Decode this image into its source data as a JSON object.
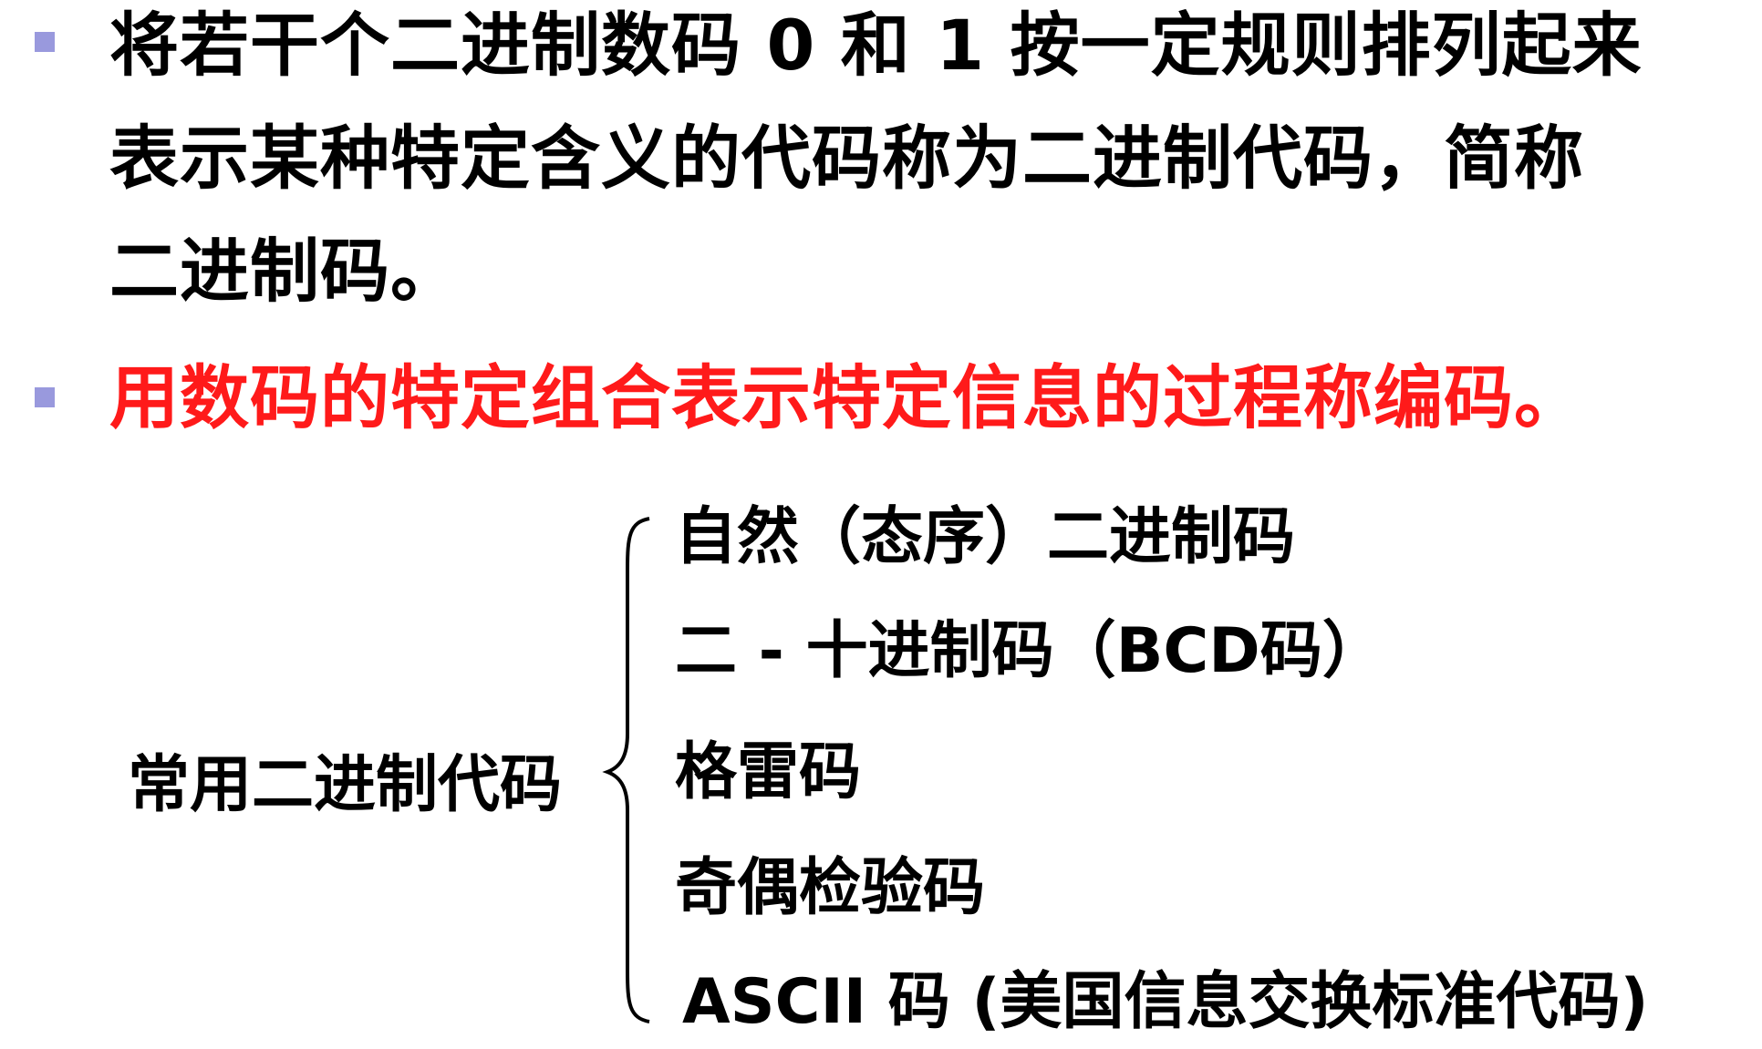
{
  "paragraphs": [
    {
      "lines": [
        "将若干个二进制数码 0 和 1 按一定规则排列起来",
        "表示某种特定含义的代码称为二进制代码，简称",
        "二进制码。"
      ],
      "color": "#000000"
    },
    {
      "lines": [
        "用数码的特定组合表示特定信息的过程称编码。"
      ],
      "color": "#ff1a1a"
    }
  ],
  "diagram": {
    "root": "常用二进制代码",
    "items": [
      "自然（态序）二进制码",
      "二 - 十进制码（BCD码）",
      "格雷码",
      "奇偶检验码",
      "ASCII 码 (美国信息交换标准代码)"
    ]
  },
  "colors": {
    "bullet": "#9999dd",
    "text": "#000000",
    "highlight": "#ff1a1a"
  }
}
